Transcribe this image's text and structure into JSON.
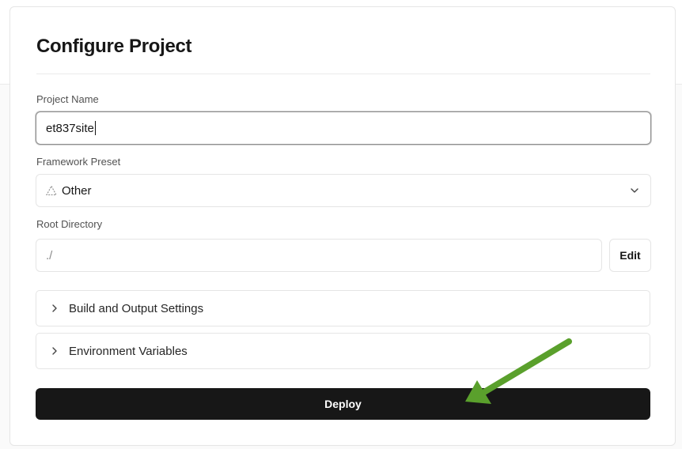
{
  "page": {
    "title": "Configure Project"
  },
  "fields": {
    "project_name_label": "Project Name",
    "project_name_value": "et837site",
    "framework_label": "Framework Preset",
    "framework_value": "Other",
    "root_dir_label": "Root Directory",
    "root_dir_value": "./",
    "edit_label": "Edit"
  },
  "sections": {
    "build_label": "Build and Output Settings",
    "env_label": "Environment Variables"
  },
  "actions": {
    "deploy_label": "Deploy"
  },
  "colors": {
    "deploy_bg": "#171717",
    "annotation_arrow": "#5aa02c"
  },
  "icons": {
    "framework": "triangle-outline-icon",
    "select": "chevron-down-icon",
    "accordion": "chevron-right-icon",
    "annotation": "arrow-annotation"
  }
}
